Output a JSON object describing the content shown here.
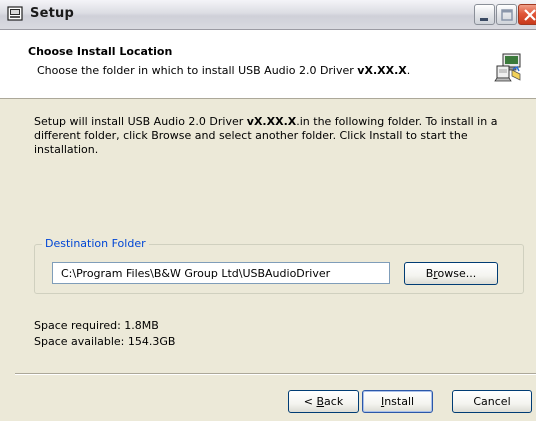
{
  "window": {
    "title": "Setup",
    "icon": "setup-window-icon"
  },
  "titlebar_buttons": {
    "minimize_icon": "minimize-icon",
    "maximize_icon": "maximize-icon",
    "close_icon": "close-icon"
  },
  "header": {
    "title": "Choose Install Location",
    "subtitle_prefix": "Choose the folder in which to install USB Audio 2.0 Driver ",
    "subtitle_version": "vX.XX.X",
    "subtitle_suffix": ".",
    "icon": "installer-computer-icon"
  },
  "intro": {
    "part1": "Setup will install USB Audio 2.0 Driver ",
    "version": "vX.XX.X",
    "part2": ".in the following folder. To install in a different folder, click Browse and select another folder. Click Install to start the installation."
  },
  "destination": {
    "group_label": "Destination Folder",
    "path_value": "C:\\Program Files\\B&W Group Ltd\\USBAudioDriver",
    "browse_pre": "B",
    "browse_access": "r",
    "browse_post": "owse..."
  },
  "space": {
    "required": "Space required: 1.8MB",
    "available": "Space available: 154.3GB"
  },
  "buttons": {
    "back_pre": "< ",
    "back_access": "B",
    "back_post": "ack",
    "install_access": "I",
    "install_post": "nstall",
    "cancel": "Cancel"
  },
  "colors": {
    "window_bg": "#ece9d8",
    "group_label": "#0046d5",
    "close_button": "#e0573a"
  }
}
